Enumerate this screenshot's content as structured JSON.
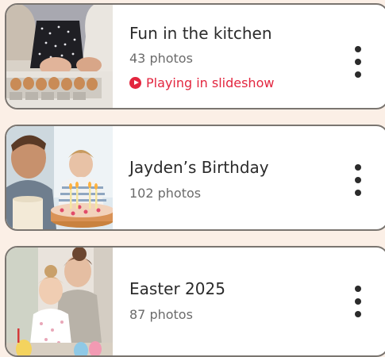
{
  "albums": [
    {
      "title": "Fun in the kitchen",
      "count": "43 photos",
      "status": "Playing in slideshow",
      "thumbnail": "family-baking-photo",
      "menu_icon": "more-vertical-icon"
    },
    {
      "title": "Jayden’s Birthday",
      "count": "102 photos",
      "thumbnail": "birthday-cake-photo",
      "menu_icon": "more-vertical-icon"
    },
    {
      "title": "Easter 2025",
      "count": "87 photos",
      "thumbnail": "mother-daughter-easter-photo",
      "menu_icon": "more-vertical-icon"
    }
  ],
  "colors": {
    "background": "#fbefe6",
    "card": "#ffffff",
    "card_border": "#7a7570",
    "status_accent": "#e3263f",
    "title_text": "#2b2b2b",
    "secondary_text": "#6b6b6b"
  }
}
